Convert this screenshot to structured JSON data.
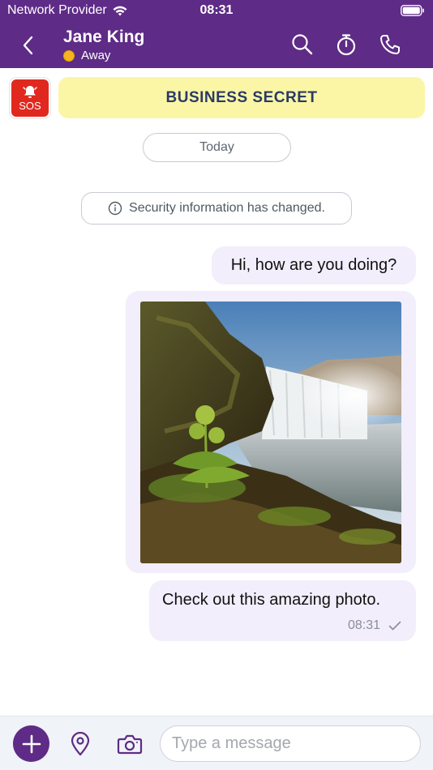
{
  "status_bar": {
    "carrier": "Network Provider",
    "time": "08:31"
  },
  "header": {
    "contact_name": "Jane King",
    "presence": "Away",
    "icons": [
      "back-icon",
      "search-icon",
      "timer-icon",
      "phone-icon"
    ],
    "bg_color": "#5e2b86"
  },
  "sos": {
    "label": "SOS",
    "color": "#e0281f"
  },
  "banner": {
    "text": "BUSINESS SECRET",
    "color": "#fbf6a6"
  },
  "chat": {
    "date_separator": "Today",
    "system_message": "Security information has changed.",
    "messages": [
      {
        "type": "text",
        "text": "Hi, how are you doing?"
      },
      {
        "type": "image",
        "description": "waterfall landscape photo"
      },
      {
        "type": "text",
        "text": "Check out this amazing photo.",
        "time": "08:31",
        "status": "sent-check-icon"
      }
    ],
    "bubble_color": "#f3eefb"
  },
  "composer": {
    "placeholder": "Type a message",
    "icons": [
      "plus-icon",
      "location-icon",
      "camera-icon"
    ]
  }
}
